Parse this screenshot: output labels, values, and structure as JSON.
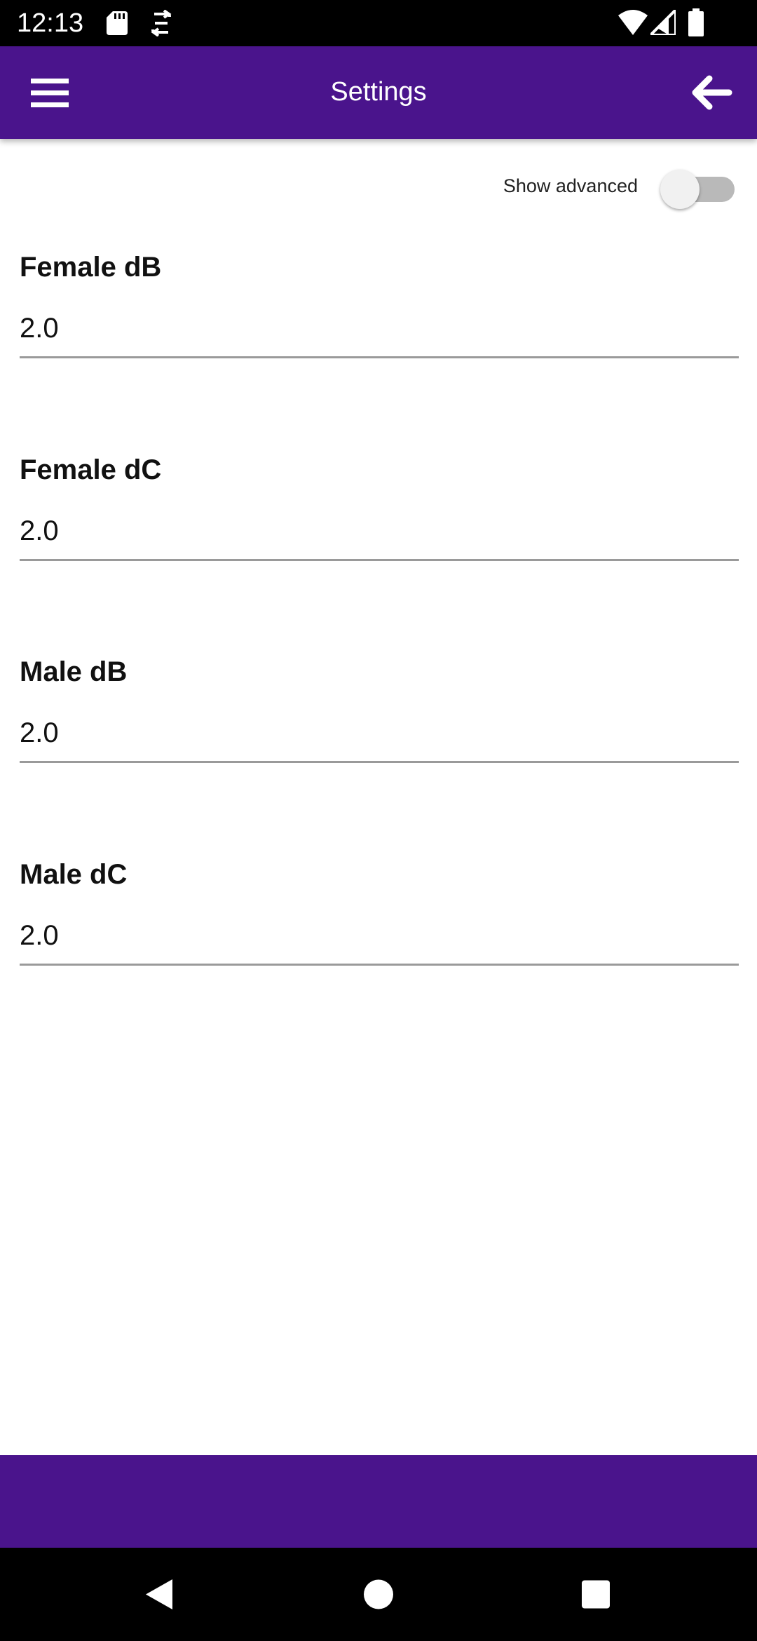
{
  "status_bar": {
    "time": "12:13",
    "icons": [
      "sd-card-icon",
      "sync-icon",
      "wifi-icon",
      "signal-icon",
      "battery-icon"
    ]
  },
  "app_bar": {
    "title": "Settings",
    "menu_icon": "menu-icon",
    "back_icon": "arrow-back-icon",
    "color": "#4a148c"
  },
  "advanced": {
    "label": "Show advanced",
    "enabled": false
  },
  "fields": [
    {
      "label": "Female dB",
      "value": "2.0"
    },
    {
      "label": "Female dC",
      "value": "2.0"
    },
    {
      "label": "Male dB",
      "value": "2.0"
    },
    {
      "label": "Male dC",
      "value": "2.0"
    }
  ],
  "nav_bar": {
    "icons": [
      "back-triangle-icon",
      "home-circle-icon",
      "recents-square-icon"
    ]
  }
}
